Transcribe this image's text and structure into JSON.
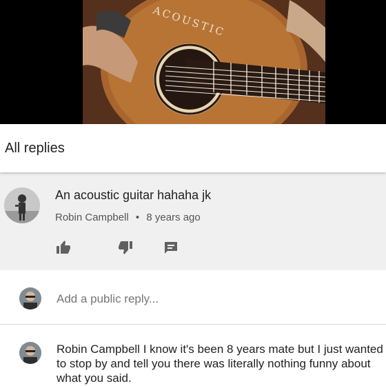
{
  "video": {
    "thumbnail_icon": "acoustic-guitar-photo",
    "guitar_label": "ACOUSTIC"
  },
  "header": {
    "title": "All replies"
  },
  "parent_comment": {
    "text": "An acoustic guitar hahaha jk",
    "author": "Robin Campbell",
    "separator": "•",
    "time": "8 years ago",
    "actions": {
      "like_icon": "thumbs-up-icon",
      "dislike_icon": "thumbs-down-icon",
      "reply_icon": "reply-comment-icon"
    }
  },
  "reply_box": {
    "placeholder": "Add a public reply..."
  },
  "replies": [
    {
      "author": "Robin Campbell",
      "text": "I know it's been 8 years mate but I just wanted to stop by and tell you there was literally nothing funny about what you said."
    }
  ],
  "colors": {
    "background": "#ffffff",
    "parent_bg": "#f0f0f0",
    "icon": "#666666",
    "meta_text": "#555555"
  }
}
